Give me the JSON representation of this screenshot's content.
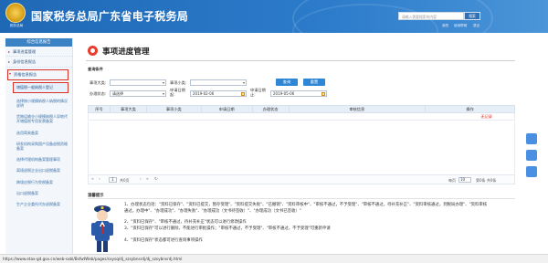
{
  "header": {
    "title": "国家税务总局广东省电子税务局",
    "emblem_caption": "税务总局",
    "search_placeholder": "请输入需要搜索的内容",
    "search_button": "搜索",
    "links": [
      "我的",
      "使用帮助",
      "退出"
    ]
  },
  "sidebar": {
    "heading": "综合信息报告",
    "items": [
      {
        "label": "事项进度管理"
      },
      {
        "label": "身份信息报告"
      }
    ],
    "group": {
      "label": "资格信息报告"
    },
    "active_sub": "增值税一般纳税人登记",
    "subs": [
      "选择按小规模纳税人纳税的情况说明",
      "货物运输业小规模纳税人异地代开增值税专用发票备案",
      "选用简易备案",
      "研发机构采购国产设备退税资格备案",
      "选择代理机构备案管理事项",
      "离境退税企业出口退税备案",
      "跨境应税行为免税备案",
      "出口退税备案",
      "生产企业委托代办退税备案"
    ]
  },
  "main": {
    "page_title": "事项进度管理",
    "query_section": "查询条件",
    "fields": {
      "matter_category_label": "事项大类:",
      "matter_category_value": "",
      "matter_subcategory_label": "事项小类:",
      "matter_subcategory_value": "",
      "status_label": "办理状态:",
      "status_value": "请选择",
      "apply_date_label": "申请日期起:",
      "apply_date_start": "2019-02-06",
      "apply_date_end_label": "申请日期止:",
      "apply_date_end": "2019-05-06"
    },
    "buttons": {
      "query": "查询",
      "reset": "重置"
    },
    "table": {
      "columns": [
        "序号",
        "事项大类",
        "事项小类",
        "申请日期",
        "办理状态",
        "审核信息",
        "操作"
      ],
      "empty_text": "无记录"
    },
    "pager": {
      "page_input": "1",
      "of_text": "共0页",
      "page_size": "10",
      "per_page_text": "每页",
      "records_text": "第0条 共0条"
    },
    "tips": {
      "title": "温馨提示",
      "lines": [
        "1、办理状态包括：\"资料已保存\"、\"资料已提交，暂存受理\"、\"资料提交失败\"、\"已撤销\"、\"资料审核中\"、\"审核不通过，不予受理\"、\"审核不通过，待补充补正\"、\"资料审核通过，到税局办理\"、\"资料审核通过，办理中\"、\"办理成功\"、\"办理失败\"、\"办理成功（文书待签收）\"、\"办理成功（文书已签收）\"",
        "2、\"资料已保存\"、\"审核不通过，待补充补正\"状态可以进行修改操作",
        "3、\"资料已保存\"可以进行删除，不能进行审批操作；\"审核不通过，不予受理\"、\"审核不通过，不予受理\"可重新申请",
        "4、\"资料已保存\"状态都可进行查询事项操作"
      ]
    }
  },
  "statusbar": {
    "url": "https://www.etax-gd.gov.cn/web-sxbl/BsfwtWeb/pages/sxysq/dj_szsybnsrdj/dj_szsybnsrdj.html"
  }
}
